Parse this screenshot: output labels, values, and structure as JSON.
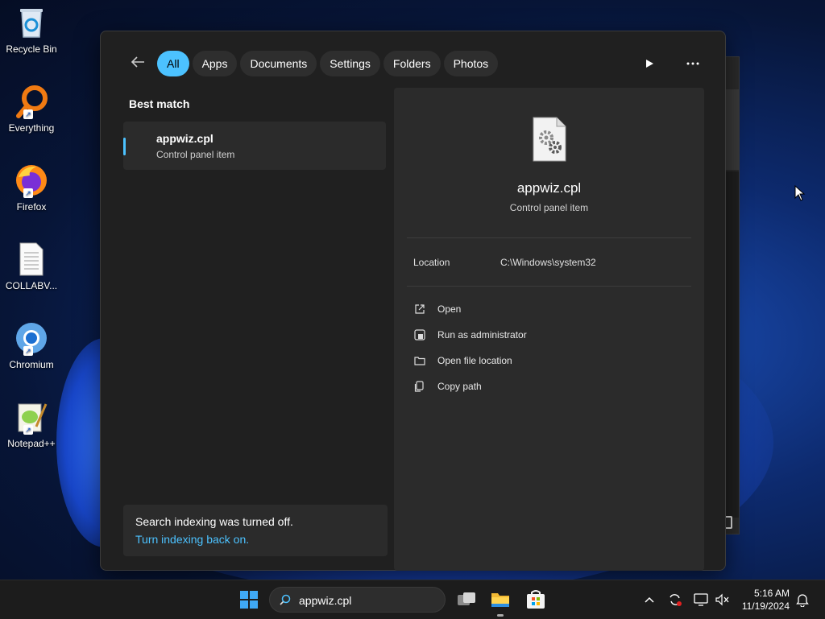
{
  "desktop": {
    "icons": [
      {
        "label": "Recycle Bin"
      },
      {
        "label": "Everything"
      },
      {
        "label": "Firefox"
      },
      {
        "label": "COLLABV..."
      },
      {
        "label": "Chromium"
      },
      {
        "label": "Notepad++"
      }
    ]
  },
  "search_panel": {
    "filters": [
      "All",
      "Apps",
      "Documents",
      "Settings",
      "Folders",
      "Photos"
    ],
    "active_filter": "All",
    "best_match_label": "Best match",
    "result": {
      "title": "appwiz.cpl",
      "subtitle": "Control panel item"
    },
    "notice": {
      "message": "Search indexing was turned off.",
      "link": "Turn indexing back on."
    },
    "detail": {
      "title": "appwiz.cpl",
      "subtitle": "Control panel item",
      "location_label": "Location",
      "location_value": "C:\\Windows\\system32",
      "actions": [
        "Open",
        "Run as administrator",
        "Open file location",
        "Copy path"
      ]
    }
  },
  "taskbar": {
    "search_value": "appwiz.cpl",
    "time": "5:16 AM",
    "date": "11/19/2024"
  },
  "colors": {
    "accent": "#4cc2ff",
    "panel_bg": "#202020",
    "card_bg": "#2b2b2b"
  }
}
